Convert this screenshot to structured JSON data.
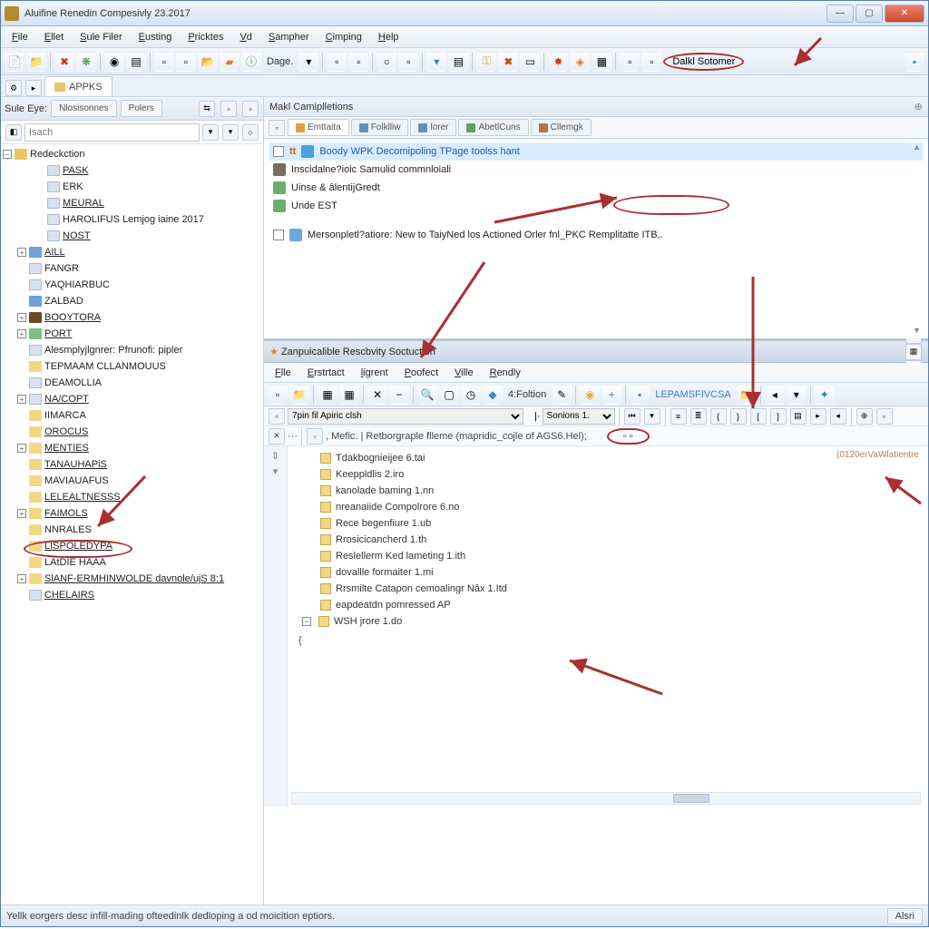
{
  "window": {
    "title": "Aluifine Renedin Compesivly 23.2017"
  },
  "menus": [
    "File",
    "Ellet",
    "Sule Filer",
    "Eusting",
    "Pricktes",
    "Vd",
    "Sampher",
    "Cimping",
    "Help"
  ],
  "toolbar": {
    "dage_label": "Dage.",
    "right_button": "Dalkl Sotomer"
  },
  "tabstrip": {
    "tab1": "APPKS"
  },
  "sidebar": {
    "label": "Sule Eye:",
    "subtab1": "Nlosisonnes",
    "subtab2": "Polers",
    "search_placeholder": "Isach",
    "tree": [
      {
        "ind": 0,
        "exp": "−",
        "icon": "ic-folder",
        "label": "Redeckction"
      },
      {
        "ind": 2,
        "icon": "ic-page",
        "label": "PASK",
        "u": true
      },
      {
        "ind": 2,
        "icon": "ic-page",
        "label": "ERK"
      },
      {
        "ind": 2,
        "icon": "ic-page",
        "label": "MEURAL",
        "u": true
      },
      {
        "ind": 2,
        "icon": "ic-page",
        "label": "HAROLIFUS Lemjog iaine 2017"
      },
      {
        "ind": 2,
        "icon": "ic-page",
        "label": "NOST",
        "u": true
      },
      {
        "ind": 1,
        "exp": "+",
        "icon": "ic-blue",
        "label": "AILL",
        "u": true
      },
      {
        "ind": 1,
        "icon": "ic-page",
        "label": "FANGR"
      },
      {
        "ind": 1,
        "icon": "ic-page",
        "label": "YAQHIARBUC"
      },
      {
        "ind": 1,
        "icon": "ic-blue",
        "label": "ZALBAD"
      },
      {
        "ind": 1,
        "exp": "+",
        "icon": "ic-brown",
        "label": "BOOYTORA",
        "u": true
      },
      {
        "ind": 1,
        "exp": "+",
        "icon": "ic-green",
        "label": "PORT",
        "u": true
      },
      {
        "ind": 1,
        "icon": "ic-page",
        "label": "Alesmplyjlgnrer: Pfrunofi: pipler"
      },
      {
        "ind": 1,
        "icon": "ic-fold2",
        "label": "TEPMAAM CLLANMOUUS"
      },
      {
        "ind": 1,
        "icon": "ic-page",
        "label": "DEAMOLLIA"
      },
      {
        "ind": 1,
        "exp": "+",
        "icon": "ic-page",
        "label": "NA/COPT",
        "u": true
      },
      {
        "ind": 1,
        "icon": "ic-fold2",
        "label": "IIMARCA"
      },
      {
        "ind": 1,
        "icon": "ic-fold2",
        "label": "OROCUS",
        "u": true
      },
      {
        "ind": 1,
        "exp": "+",
        "icon": "ic-fold2",
        "label": "MENTIES",
        "u": true
      },
      {
        "ind": 1,
        "icon": "ic-fold2",
        "label": "TANAUHAPiS",
        "u": true,
        "circled": true
      },
      {
        "ind": 1,
        "icon": "ic-fold2",
        "label": "MAVIAUAFUS"
      },
      {
        "ind": 1,
        "icon": "ic-fold2",
        "label": "LELEALTNESSS",
        "u": true
      },
      {
        "ind": 1,
        "exp": "+",
        "icon": "ic-fold2",
        "label": "FAIMOLS",
        "u": true
      },
      {
        "ind": 1,
        "icon": "ic-fold2",
        "label": "NNRALES"
      },
      {
        "ind": 1,
        "icon": "ic-fold2",
        "label": "LISPOLEDYPA",
        "u": true
      },
      {
        "ind": 1,
        "icon": "ic-fold2",
        "label": "LAtDIE HAAA"
      },
      {
        "ind": 1,
        "exp": "+",
        "icon": "ic-fold2",
        "label": "SlANF-ERMHINWOLDE davnole/ujS 8:1",
        "u": true
      },
      {
        "ind": 1,
        "icon": "ic-page",
        "label": "CHELAIRS",
        "u": true
      }
    ]
  },
  "upper_pane": {
    "title": "Makl Camiplletions",
    "tabs": [
      "Emttaita",
      "Folklliw",
      "lorer",
      "AbetlCuns",
      "Cllemgk"
    ],
    "rows": [
      {
        "hl": true,
        "icon": "#4aa0e0",
        "text": "Boody WPK Decomipoling TPage toolss hant"
      },
      {
        "icon": "#7a6a5a",
        "text": "Inscidalne?ioic Samulid commnloiali"
      },
      {
        "icon": "#6bb06a",
        "text": "Uinse & âlentijGredt"
      },
      {
        "icon": "#6bb06a",
        "text": "Unde EST"
      },
      {
        "spacer": true
      },
      {
        "cb": true,
        "icon": "#6aa8e0",
        "text": "Mersonpletl?atiore: New to TaiyNed los Actioned Orler fnl_PKC Remplitatte ITB,."
      }
    ]
  },
  "child": {
    "title": "Zanpuicalible Rescbvity Soctuction",
    "menus": [
      "Flle",
      "Erstrtact",
      "ligrent",
      "Poofect",
      "Ville",
      "Rendly"
    ],
    "tb_text": "4:Foltion",
    "tb_label": "LEPAMSFIVCSA",
    "path_value": "7pin fil Apiric clsh",
    "sonions": "Sonions 1.",
    "breadcrumb": ", Mefic. | Retborgraple flleme (mapridic_cojle of AGS6.Hel);",
    "date_stamp": "(0120erVaWlatientre",
    "files": [
      "Tdakbognieijee 6.tai",
      "Keeppldlis 2.iro",
      "kanolade baming 1.nn",
      "nreanaiide Compolrore 6.no",
      "Rece begenfiure  1.ub",
      "Rrosicicancherd 1.th",
      "Reslellerm Ked lameting  1.ith",
      "dovallle formaiter 1.mi",
      "Rrsmilte Catapon cemoalingr Nâx 1.Itd",
      "eapdeatdn pomressed  AP",
      "WSH jrore 1.do"
    ]
  },
  "status": {
    "text": "Yellk eorgers desc infill-mading ofteedinlk dedloping a od moicition eptiors.",
    "btn": "Alsri"
  }
}
